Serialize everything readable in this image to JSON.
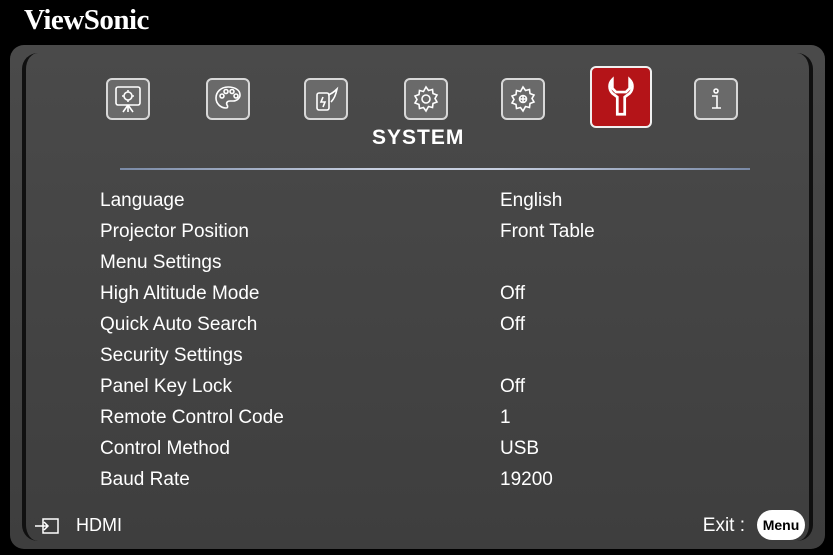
{
  "brand": "ViewSonic",
  "tabs": [
    {
      "icon": "display-icon",
      "active": false
    },
    {
      "icon": "palette-icon",
      "active": false
    },
    {
      "icon": "power-icon",
      "active": false
    },
    {
      "icon": "gear-icon",
      "active": false
    },
    {
      "icon": "advanced-gear-icon",
      "active": false
    },
    {
      "icon": "wrench-icon",
      "active": true
    },
    {
      "icon": "info-icon",
      "active": false
    }
  ],
  "section_title": "SYSTEM",
  "menu_items": [
    {
      "label": "Language",
      "value": "English"
    },
    {
      "label": "Projector Position",
      "value": "Front Table"
    },
    {
      "label": "Menu Settings",
      "value": ""
    },
    {
      "label": "High Altitude Mode",
      "value": "Off"
    },
    {
      "label": "Quick Auto Search",
      "value": "Off"
    },
    {
      "label": "Security Settings",
      "value": ""
    },
    {
      "label": "Panel Key Lock",
      "value": "Off"
    },
    {
      "label": "Remote Control Code",
      "value": "1"
    },
    {
      "label": "Control Method",
      "value": "USB"
    },
    {
      "label": "Baud Rate",
      "value": "19200"
    }
  ],
  "footer": {
    "source": "HDMI",
    "exit_label": "Exit :",
    "menu_button": "Menu"
  },
  "colors": {
    "active_tab": "#b41418",
    "panel": "#444444"
  }
}
